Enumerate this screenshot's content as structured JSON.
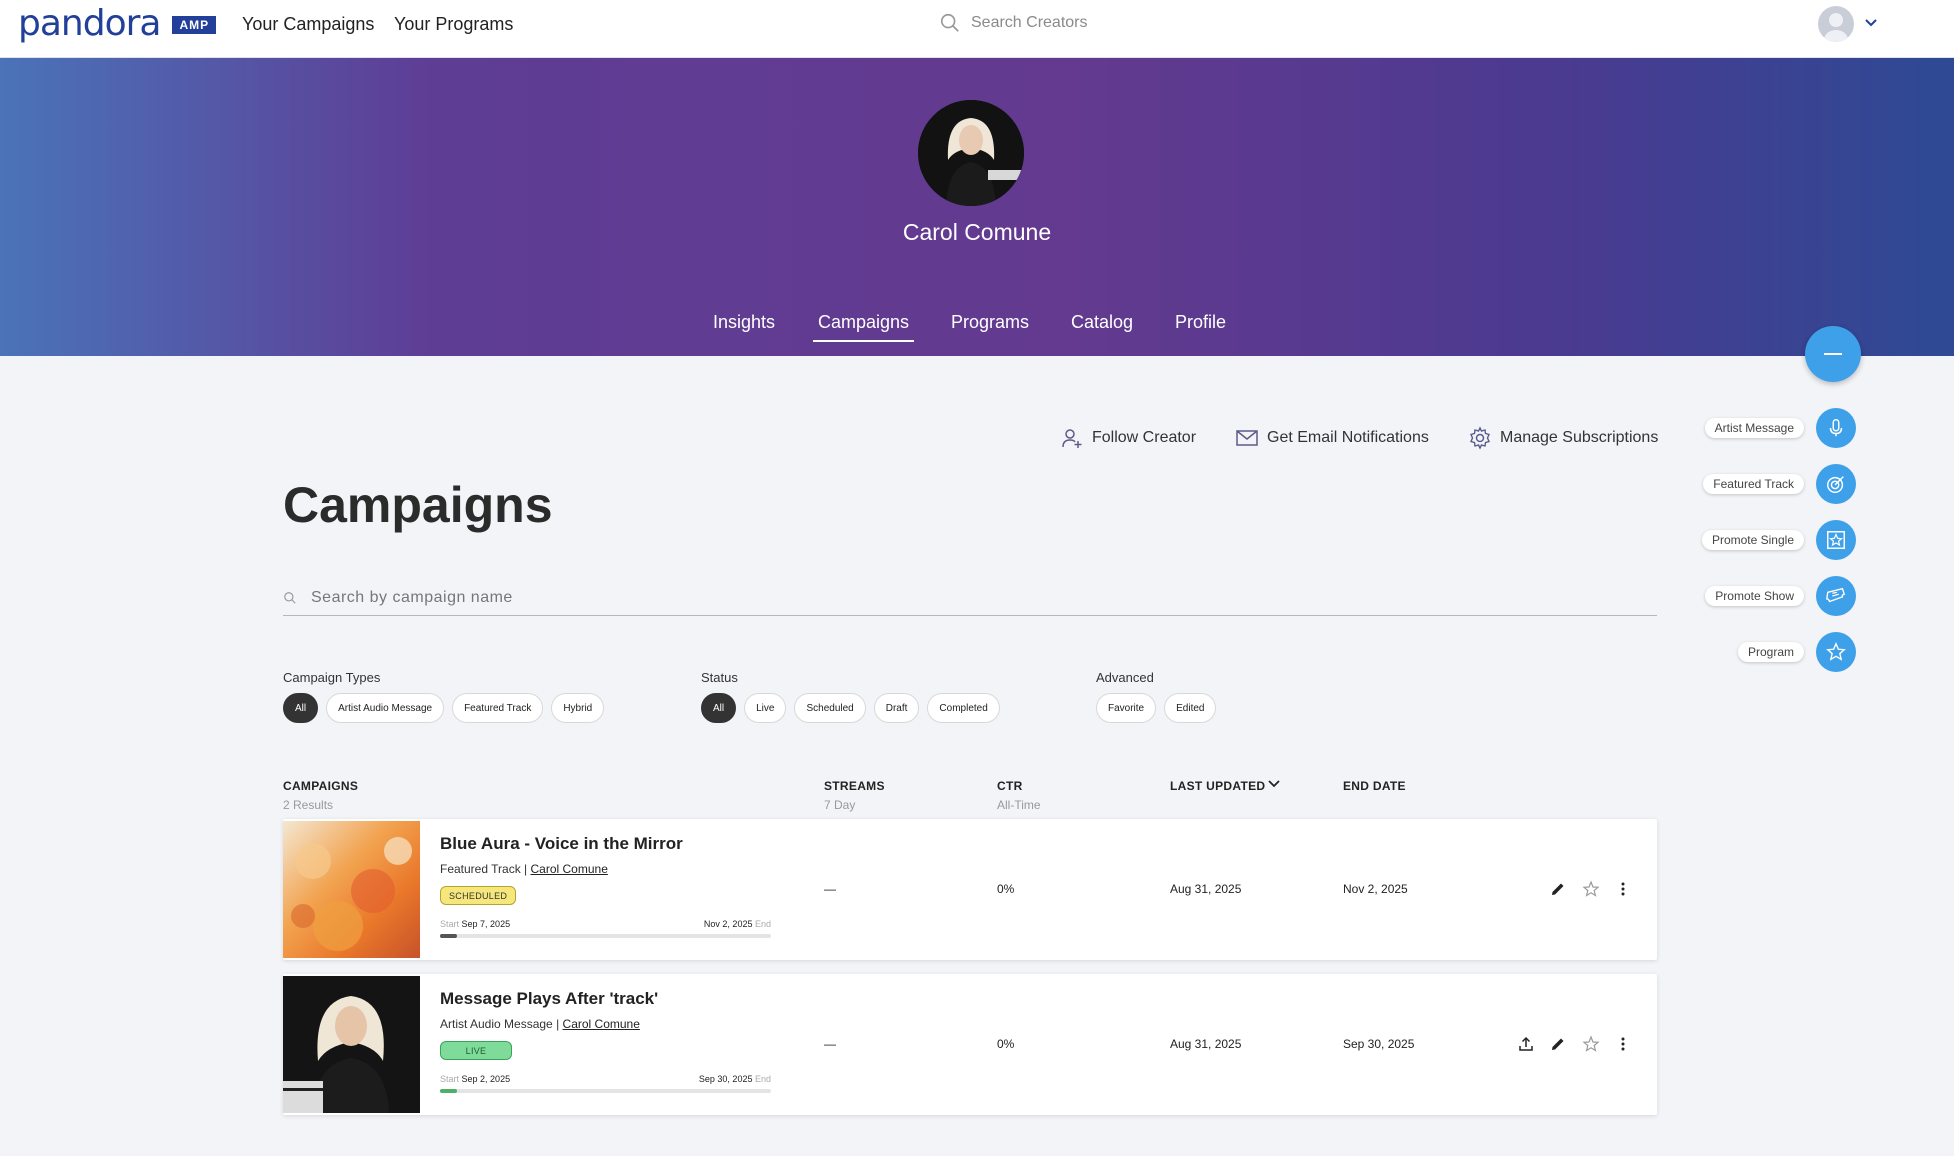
{
  "topnav": {
    "logo_text": "pandora",
    "logo_badge": "AMP",
    "links": [
      "Your Campaigns",
      "Your Programs"
    ],
    "search_placeholder": "Search Creators"
  },
  "hero": {
    "artist_name": "Carol Comune",
    "tabs": [
      "Insights",
      "Campaigns",
      "Programs",
      "Catalog",
      "Profile"
    ],
    "active_tab": "Campaigns"
  },
  "fab": {
    "items": [
      {
        "label": "Artist Message",
        "icon": "microphone-icon"
      },
      {
        "label": "Featured Track",
        "icon": "target-icon"
      },
      {
        "label": "Promote Single",
        "icon": "star-frame-icon"
      },
      {
        "label": "Promote Show",
        "icon": "ticket-icon"
      },
      {
        "label": "Program",
        "icon": "star-icon"
      }
    ]
  },
  "actions": {
    "follow": "Follow Creator",
    "email": "Get Email Notifications",
    "subscriptions": "Manage Subscriptions"
  },
  "page_title": "Campaigns",
  "campaign_search": {
    "placeholder": "Search by campaign name"
  },
  "filters": {
    "types": {
      "title": "Campaign Types",
      "chips": [
        "All",
        "Artist Audio Message",
        "Featured Track",
        "Hybrid"
      ],
      "selected": "All"
    },
    "status": {
      "title": "Status",
      "chips": [
        "All",
        "Live",
        "Scheduled",
        "Draft",
        "Completed"
      ],
      "selected": "All"
    },
    "advanced": {
      "title": "Advanced",
      "chips": [
        "Favorite",
        "Edited"
      ]
    }
  },
  "table": {
    "headers": {
      "campaigns": "CAMPAIGNS",
      "campaigns_sub": "2 Results",
      "streams": "STREAMS",
      "streams_sub": "7 Day",
      "ctr": "CTR",
      "ctr_sub": "All-Time",
      "last_updated": "LAST UPDATED",
      "end_date": "END DATE"
    },
    "rows": [
      {
        "title": "Blue Aura - Voice in the Mirror",
        "type": "Featured Track",
        "artist": "Carol Comune",
        "status": "SCHEDULED",
        "start_label": "Start",
        "start": "Sep 7, 2025",
        "end": "Nov 2, 2025",
        "end_label": "End",
        "progress": 0.05,
        "progress_color": "#555555",
        "streams": "—",
        "ctr": "0%",
        "last_updated": "Aug 31, 2025",
        "end_date": "Nov 2, 2025"
      },
      {
        "title": "Message Plays After 'track'",
        "type": "Artist Audio Message",
        "artist": "Carol Comune",
        "status": "LIVE",
        "start_label": "Start",
        "start": "Sep 2, 2025",
        "end": "Sep 30, 2025",
        "end_label": "End",
        "progress": 0.05,
        "progress_color": "#4caf6a",
        "streams": "—",
        "ctr": "0%",
        "last_updated": "Aug 31, 2025",
        "end_date": "Sep 30, 2025"
      }
    ]
  }
}
